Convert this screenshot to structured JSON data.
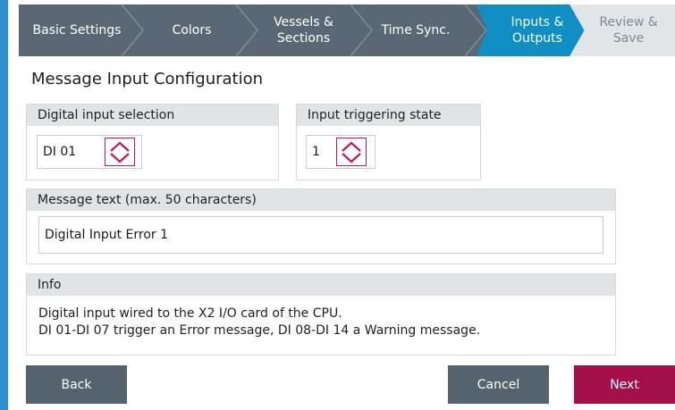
{
  "wizard": {
    "steps": [
      {
        "lines": [
          "Basic Settings"
        ],
        "state": "done"
      },
      {
        "lines": [
          "Colors"
        ],
        "state": "done"
      },
      {
        "lines": [
          "Vessels &",
          "Sections"
        ],
        "state": "done"
      },
      {
        "lines": [
          "Time Sync."
        ],
        "state": "done"
      },
      {
        "lines": [
          "Inputs &",
          "Outputs"
        ],
        "state": "active"
      },
      {
        "lines": [
          "Review &",
          "Save"
        ],
        "state": "disabled"
      }
    ]
  },
  "page": {
    "title": "Message Input Configuration"
  },
  "digital_input": {
    "label": "Digital input selection",
    "value": "DI 01"
  },
  "trigger_state": {
    "label": "Input triggering state",
    "value": "1"
  },
  "message": {
    "label": "Message text (max. 50 characters)",
    "value": "Digital Input Error 1"
  },
  "info": {
    "label": "Info",
    "lines": [
      "Digital input wired to the X2 I/O card of the CPU.",
      "DI 01-DI 07 trigger an Error message, DI 08-DI 14 a Warning message."
    ]
  },
  "buttons": {
    "back": "Back",
    "cancel": "Cancel",
    "next": "Next"
  },
  "colors": {
    "accent": "#0f8fc4",
    "brand": "#a4114a",
    "header": "#5a6875"
  }
}
